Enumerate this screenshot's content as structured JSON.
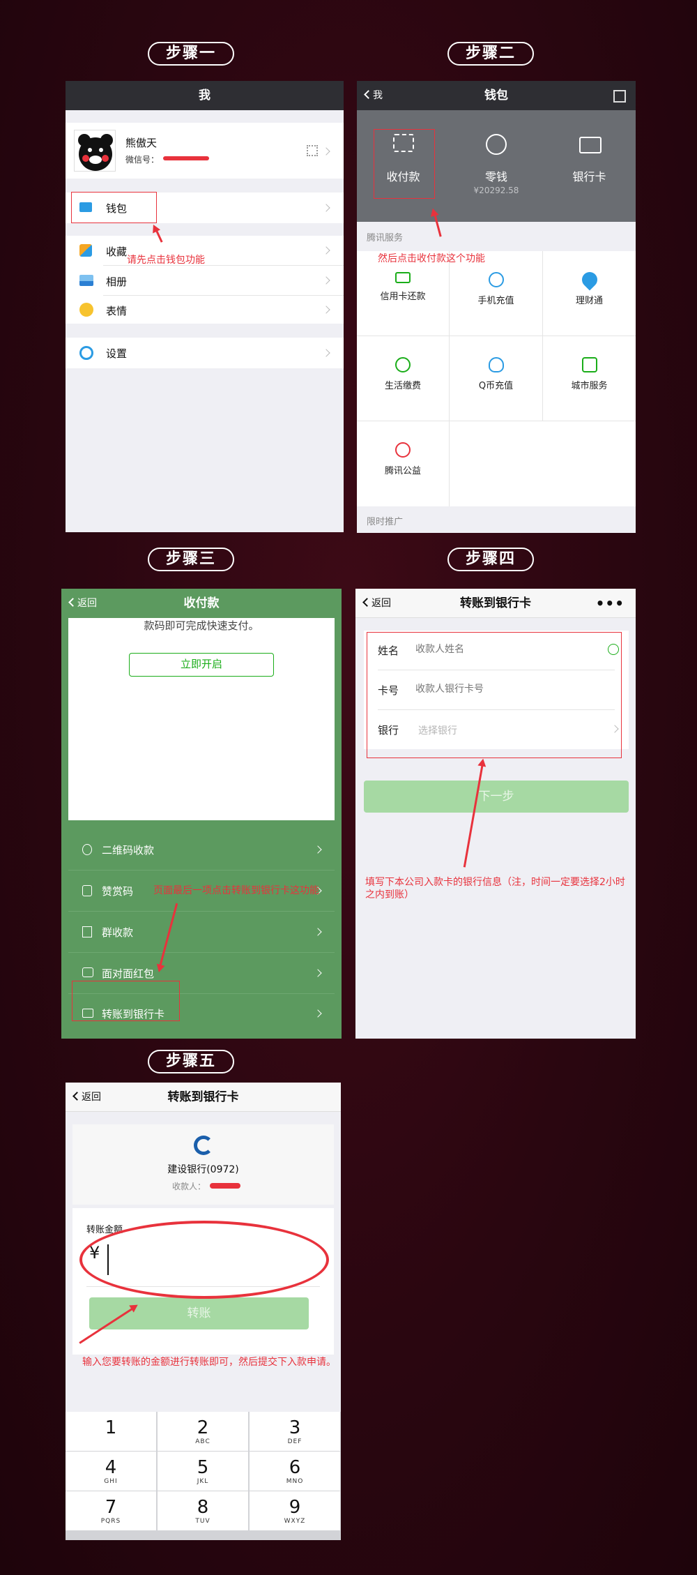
{
  "steps": {
    "s1": "步骤一",
    "s2": "步骤二",
    "s3": "步骤三",
    "s4": "步骤四",
    "s5": "步骤五"
  },
  "me_screen": {
    "nav_title": "我",
    "profile_name": "熊傲天",
    "wechat_id_label": "微信号：",
    "menu": {
      "wallet": "钱包",
      "favorites": "收藏",
      "album": "相册",
      "stickers": "表情",
      "settings": "设置"
    },
    "note": "请先点击钱包功能"
  },
  "wallet_screen": {
    "back": "我",
    "nav_title": "钱包",
    "top": {
      "pay": "收付款",
      "change": "零钱",
      "change_amount": "¥20292.58",
      "cards": "银行卡"
    },
    "section_tencent": "腾讯服务",
    "services": [
      "信用卡还款",
      "手机充值",
      "理财通",
      "生活缴费",
      "Q币充值",
      "城市服务",
      "腾讯公益"
    ],
    "section_promo": "限时推广",
    "note": "然后点击收付款这个功能"
  },
  "pay_screen": {
    "back": "返回",
    "nav_title": "收付款",
    "card_text": "款码即可完成快速支付。",
    "enable_button": "立即开启",
    "items": [
      "二维码收款",
      "赞赏码",
      "群收款",
      "面对面红包",
      "转账到银行卡"
    ],
    "note": "页面最后一项点击转账到银行卡这功能"
  },
  "bank_form_screen": {
    "back": "返回",
    "nav_title": "转账到银行卡",
    "fields": {
      "name_label": "姓名",
      "name_placeholder": "收款人姓名",
      "card_label": "卡号",
      "card_placeholder": "收款人银行卡号",
      "bank_label": "银行",
      "bank_placeholder": "选择银行"
    },
    "next_button": "下一步",
    "note": "填写下本公司入款卡的银行信息（注，时间一定要选择2小时之内到账）"
  },
  "amount_screen": {
    "back": "返回",
    "nav_title": "转账到银行卡",
    "bank_name": "建设银行(0972)",
    "payee_label": "收款人：",
    "amount_label": "转账金额",
    "currency": "¥",
    "transfer_button": "转账",
    "note": "输入您要转账的金额进行转账即可，然后提交下入款申请。",
    "keypad": [
      {
        "n": "1",
        "l": ""
      },
      {
        "n": "2",
        "l": "ABC"
      },
      {
        "n": "3",
        "l": "DEF"
      },
      {
        "n": "4",
        "l": "GHI"
      },
      {
        "n": "5",
        "l": "JKL"
      },
      {
        "n": "6",
        "l": "MNO"
      },
      {
        "n": "7",
        "l": "PQRS"
      },
      {
        "n": "8",
        "l": "TUV"
      },
      {
        "n": "9",
        "l": "WXYZ"
      }
    ]
  },
  "colors": {
    "wechat_green": "#1aad19",
    "dark_nav": "#2e2e33",
    "wallet_gray": "#6a6d72",
    "annotation_red": "#e8323c"
  }
}
